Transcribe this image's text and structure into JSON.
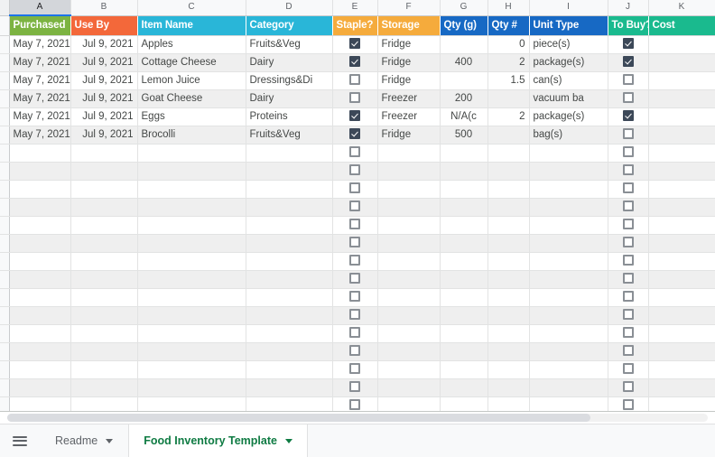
{
  "spreadsheet": {
    "column_letters": [
      "A",
      "B",
      "C",
      "D",
      "E",
      "F",
      "G",
      "H",
      "I",
      "J",
      "K"
    ],
    "selected_column": "A",
    "headers": [
      {
        "label": "Purchased",
        "color": "#7cb342"
      },
      {
        "label": "Use By",
        "color": "#f3683a"
      },
      {
        "label": "Item Name",
        "color": "#29b6d8"
      },
      {
        "label": "Category",
        "color": "#29b6d8"
      },
      {
        "label": "Staple?",
        "color": "#f5ab3c"
      },
      {
        "label": "Storage",
        "color": "#f5ab3c"
      },
      {
        "label": "Qty (g)",
        "color": "#1769c4"
      },
      {
        "label": "Qty #",
        "color": "#1769c4"
      },
      {
        "label": "Unit Type",
        "color": "#1769c4"
      },
      {
        "label": "To Buy?",
        "color": "#1aba8e"
      },
      {
        "label": "Cost",
        "color": "#1aba8e"
      }
    ],
    "rows": [
      {
        "purchased": "May 7, 2021",
        "use_by": "Jul 9, 2021",
        "item_name": "Apples",
        "category": "Fruits&Veg",
        "staple": true,
        "storage": "Fridge",
        "qty_g": "",
        "qty_num": "0",
        "unit_type": "piece(s)",
        "to_buy": true,
        "cost": ""
      },
      {
        "purchased": "May 7, 2021",
        "use_by": "Jul 9, 2021",
        "item_name": "Cottage Cheese",
        "category": "Dairy",
        "staple": true,
        "storage": "Fridge",
        "qty_g": "400",
        "qty_num": "2",
        "unit_type": "package(s)",
        "to_buy": true,
        "cost": ""
      },
      {
        "purchased": "May 7, 2021",
        "use_by": "Jul 9, 2021",
        "item_name": "Lemon Juice",
        "category": "Dressings&Di",
        "staple": false,
        "storage": "Fridge",
        "qty_g": "",
        "qty_num": "1.5",
        "unit_type": "can(s)",
        "to_buy": false,
        "cost": ""
      },
      {
        "purchased": "May 7, 2021",
        "use_by": "Jul 9, 2021",
        "item_name": "Goat Cheese",
        "category": "Dairy",
        "staple": false,
        "storage": "Freezer",
        "qty_g": "200",
        "qty_num": "",
        "unit_type": "vacuum ba",
        "to_buy": false,
        "cost": ""
      },
      {
        "purchased": "May 7, 2021",
        "use_by": "Jul 9, 2021",
        "item_name": "Eggs",
        "category": "Proteins",
        "staple": true,
        "storage": "Freezer",
        "qty_g": "N/A(c",
        "qty_num": "2",
        "unit_type": "package(s)",
        "to_buy": true,
        "cost": ""
      },
      {
        "purchased": "May 7, 2021",
        "use_by": "Jul 9, 2021",
        "item_name": "Brocolli",
        "category": "Fruits&Veg",
        "staple": true,
        "storage": "Fridge",
        "qty_g": "500",
        "qty_num": "",
        "unit_type": "bag(s)",
        "to_buy": false,
        "cost": ""
      }
    ],
    "empty_row_count": 16
  },
  "tabbar": {
    "all_sheets_label": "all-sheets-menu",
    "tabs": [
      {
        "label": "Readme",
        "active": false
      },
      {
        "label": "Food Inventory Template",
        "active": true
      }
    ]
  }
}
